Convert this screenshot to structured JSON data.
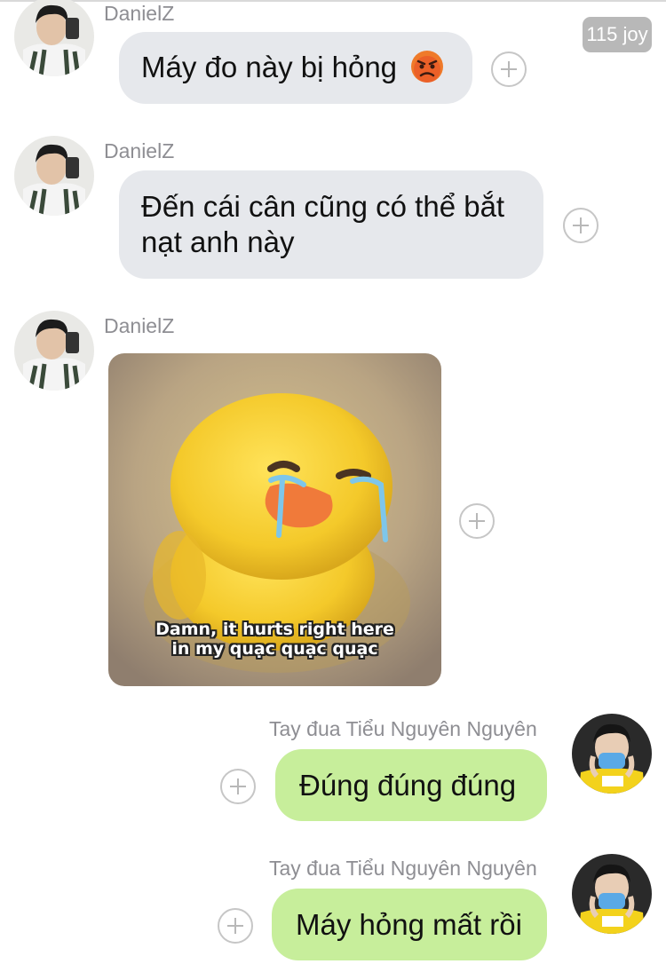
{
  "reaction_badge": "115 joy",
  "messages": [
    {
      "sender": "DanielZ",
      "text": "Máy đo này bị hỏng",
      "emoji": "angry-face"
    },
    {
      "sender": "DanielZ",
      "text": "Đến cái cân cũng có thể bắt nạt anh này"
    },
    {
      "sender": "DanielZ",
      "sticker_caption_1": "Damn, it hurts right here",
      "sticker_caption_2": "in my quạc quạc quạc"
    },
    {
      "sender": "Tay đua Tiểu Nguyên Nguyên",
      "text": "Đúng đúng đúng"
    },
    {
      "sender": "Tay đua Tiểu Nguyên Nguyên",
      "text": "Máy hỏng mất rồi"
    }
  ],
  "colors": {
    "incoming_bubble": "#e6e8ec",
    "outgoing_bubble": "#c7ee9b",
    "sender_text": "#8e8e93"
  }
}
